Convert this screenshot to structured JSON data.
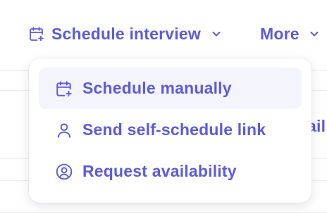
{
  "toolbar": {
    "schedule_interview_label": "Schedule interview",
    "more_label": "More"
  },
  "menu": {
    "items": [
      {
        "label": "Schedule manually",
        "icon": "calendar-plus-icon",
        "highlighted": true
      },
      {
        "label": "Send self-schedule link",
        "icon": "user-icon",
        "highlighted": false
      },
      {
        "label": "Request availability",
        "icon": "user-circle-icon",
        "highlighted": false
      }
    ]
  },
  "background": {
    "partial_text": "ail"
  },
  "colors": {
    "accent": "#5b5bdc",
    "menu_highlight": "#f4f4fd",
    "divider": "#ebebf0"
  }
}
